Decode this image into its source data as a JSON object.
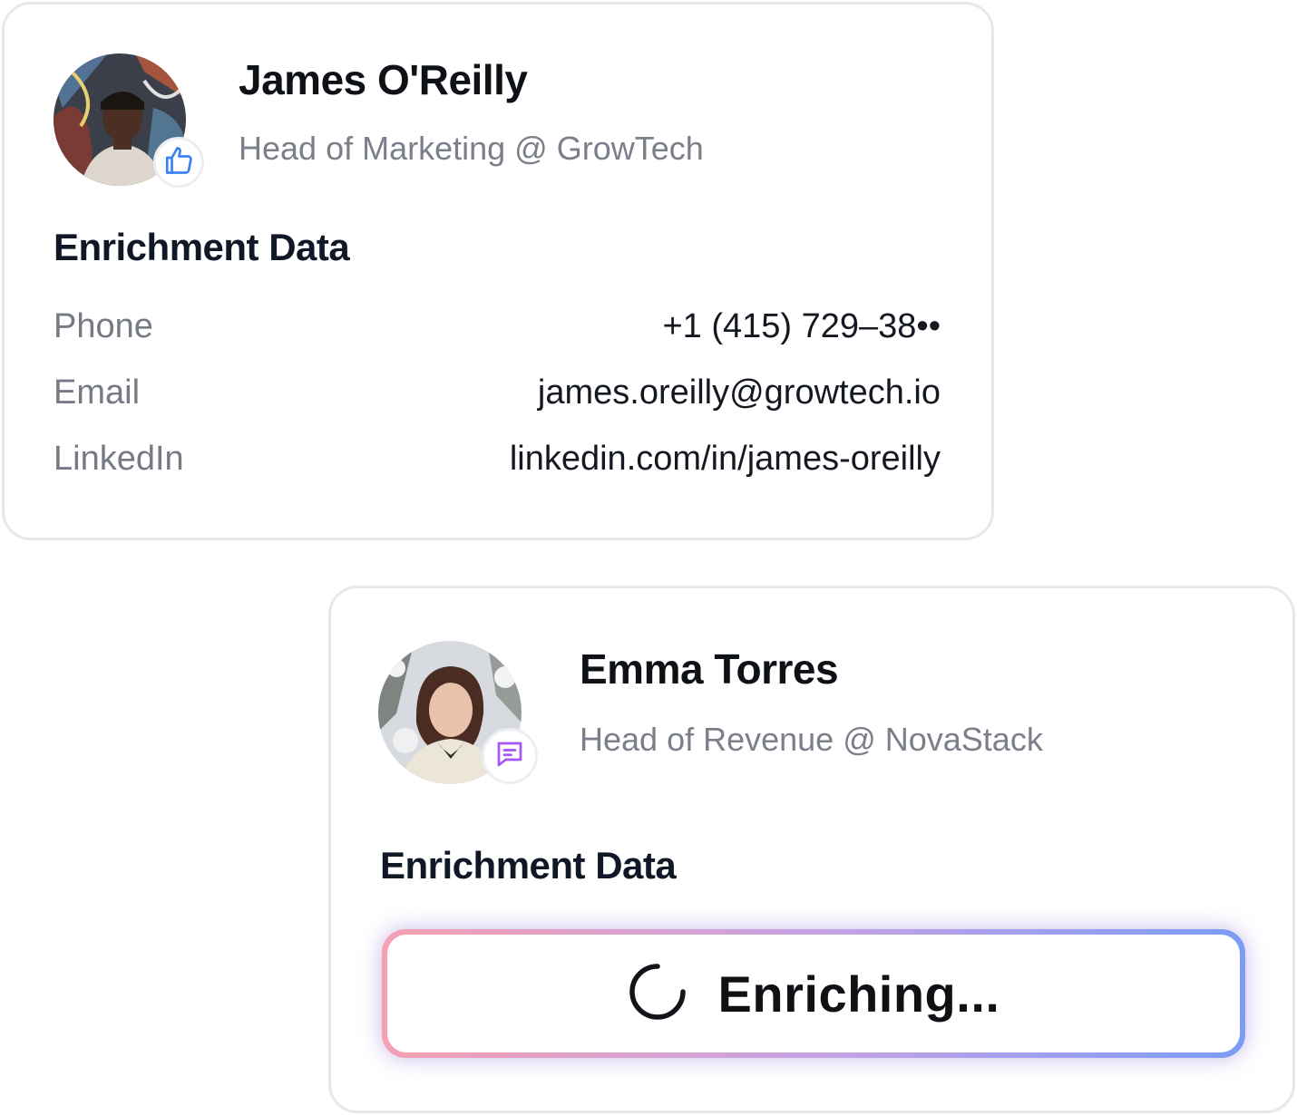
{
  "cards": [
    {
      "name": "James O'Reilly",
      "title": "Head of Marketing @ GrowTech",
      "badge_icon": "thumbs-up-icon",
      "badge_color": "#3b82f6",
      "section_heading": "Enrichment Data",
      "fields": [
        {
          "label": "Phone",
          "value": "+1 (415) 729–38••"
        },
        {
          "label": "Email",
          "value": "james.oreilly@growtech.io"
        },
        {
          "label": "LinkedIn",
          "value": "linkedin.com/in/james-oreilly"
        }
      ]
    },
    {
      "name": "Emma Torres",
      "title": "Head of Revenue @ NovaStack",
      "badge_icon": "chat-message-icon",
      "badge_color": "#a855f7",
      "section_heading": "Enrichment Data",
      "status": {
        "icon": "spinner-icon",
        "label": "Enriching...",
        "gradient_colors": [
          "#f4a0b0",
          "#c8a2e4",
          "#7b9df6"
        ]
      }
    }
  ]
}
